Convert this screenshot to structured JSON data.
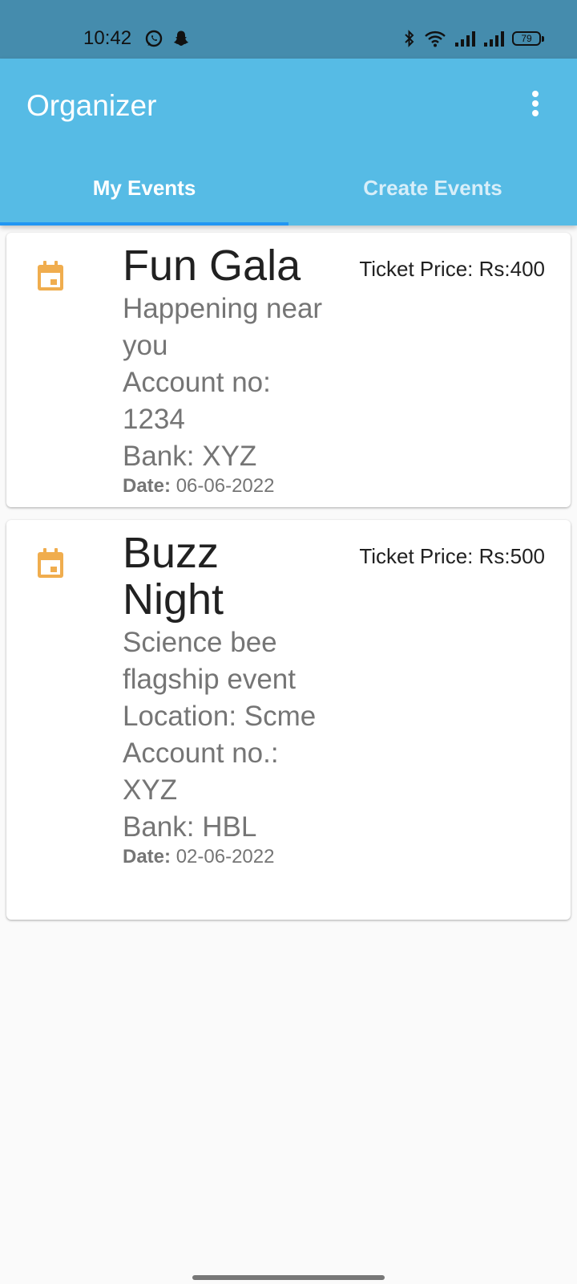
{
  "status_bar": {
    "time": "10:42",
    "battery": "79",
    "icons": [
      "whatsapp-icon",
      "snapchat-icon",
      "bluetooth-icon",
      "wifi-icon",
      "signal-icon",
      "signal-icon",
      "battery-icon"
    ]
  },
  "app_bar": {
    "title": "Organizer",
    "menu_icon": "more-vert-icon"
  },
  "tabs": [
    {
      "label": "My Events",
      "active": true
    },
    {
      "label": "Create Events",
      "active": false
    }
  ],
  "colors": {
    "app_bar": "#56bbe5",
    "status_bar": "#458cad",
    "tab_indicator": "#2196f3",
    "event_icon": "#f0ad4e"
  },
  "events": [
    {
      "icon": "calendar-icon",
      "title": "Fun Gala",
      "description": "Happening near you\nAccount no: 1234\nBank: XYZ",
      "date_label": "Date:",
      "date_value": "06-06-2022",
      "price": "Ticket Price: Rs:400"
    },
    {
      "icon": "calendar-icon",
      "title": "Buzz Night",
      "description": "Science bee flagship event\nLocation: Scme\nAccount no.: XYZ\nBank: HBL",
      "date_label": "Date:",
      "date_value": "02-06-2022",
      "price": "Ticket Price: Rs:500"
    }
  ]
}
